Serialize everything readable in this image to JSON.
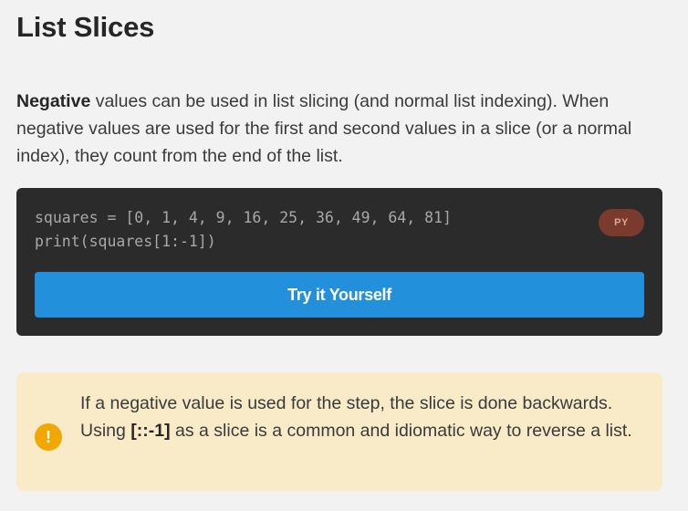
{
  "heading": "List Slices",
  "intro": {
    "bold": "Negative",
    "text": " values can be used in list slicing (and normal list indexing). When negative values are used for the first and second values in a slice (or a normal index), they count from the end of the list."
  },
  "code_block": {
    "lines": [
      "squares = [0, 1, 4, 9, 16, 25, 36, 49, 64, 81]",
      "print(squares[1:-1])"
    ],
    "language_badge": "PY",
    "try_button_label": "Try it Yourself"
  },
  "note": {
    "icon": "exclamation-icon",
    "text_before": "If a negative value is used for the step, the slice is done backwards. Using ",
    "bold": "[::-1]",
    "text_after": " as a slice is a common and idiomatic way to reverse a list."
  },
  "colors": {
    "background": "#f2f2f2",
    "code_background": "#2b2b2b",
    "button": "#2390db",
    "badge": "#7a3a2c",
    "note_background": "#f9ebc8",
    "warning": "#f0a800"
  }
}
